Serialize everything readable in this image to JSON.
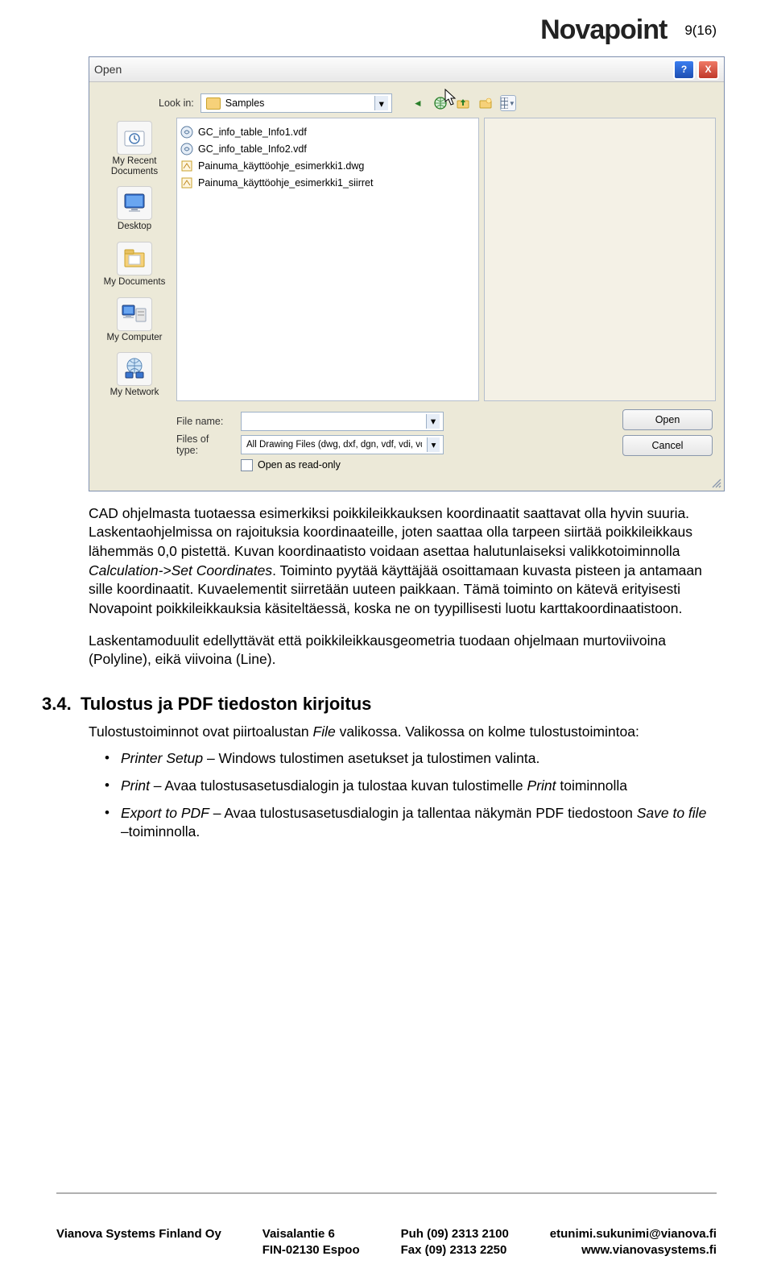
{
  "header": {
    "page_number": "9(16)",
    "logo": "Novapoint"
  },
  "dialog": {
    "title": "Open",
    "help": "?",
    "close": "X",
    "lookin_label": "Look in:",
    "lookin_value": "Samples",
    "nav_icons": {
      "back": "◄",
      "globe": "🌐",
      "up": "folder-up",
      "new": "folder-new",
      "view": "▥"
    },
    "places": [
      {
        "label": "My Recent\nDocuments",
        "icon": "recent"
      },
      {
        "label": "Desktop",
        "icon": "desktop"
      },
      {
        "label": "My Documents",
        "icon": "documents"
      },
      {
        "label": "My Computer",
        "icon": "computer"
      },
      {
        "label": "My Network",
        "icon": "network"
      }
    ],
    "files": [
      {
        "name": "GC_info_table_Info1.vdf",
        "type": "vdf"
      },
      {
        "name": "GC_info_table_Info2.vdf",
        "type": "vdf"
      },
      {
        "name": "Painuma_käyttöohje_esimerkki1.dwg",
        "type": "dwg"
      },
      {
        "name": "Painuma_käyttöohje_esimerkki1_siirret",
        "type": "dwg"
      }
    ],
    "filename_label": "File name:",
    "filetypes_label": "Files of type:",
    "filetypes_value": "All Drawing Files (dwg, dxf, dgn, vdf, vdi, vdp)",
    "readonly_label": "Open as read-only",
    "open_btn": "Open",
    "cancel_btn": "Cancel"
  },
  "body": {
    "p1_a": "CAD ohjelmasta tuotaessa esimerkiksi poikkileikkauksen koordinaatit saattavat olla hyvin suuria. Laskentaohjelmissa on rajoituksia koordinaateille, joten saattaa olla tarpeen siirtää poikkileikkaus lähemmäs 0,0 pistettä. Kuvan koordinaatisto voidaan asettaa halutunlaiseksi valikkotoiminnolla ",
    "p1_i": "Calculation->Set Coordinates",
    "p1_b": ". Toiminto pyytää käyttäjää osoittamaan kuvasta pisteen ja antamaan sille koordinaatit. Kuvaelementit siirretään uuteen paikkaan. Tämä toiminto on kätevä erityisesti Novapoint poikkileikkauksia käsiteltäessä, koska ne on tyypillisesti luotu karttakoordinaatistoon.",
    "p2": "Laskentamoduulit edellyttävät että poikkileikkausgeometria tuodaan ohjelmaan murtoviivoina (Polyline), eikä viivoina (Line)."
  },
  "section": {
    "number": "3.4.",
    "title": "Tulostus ja PDF tiedoston kirjoitus",
    "intro_a": "Tulostustoiminnot ovat piirtoalustan ",
    "intro_i": "File",
    "intro_b": " valikossa. Valikossa on kolme tulostustoimintoa:",
    "bullets": [
      {
        "i": "Printer Setup",
        "t": " – Windows tulostimen asetukset ja tulostimen valinta."
      },
      {
        "i": "Print",
        "t": " – Avaa tulostusasetusdialogin ja tulostaa kuvan tulostimelle ",
        "i2": "Print",
        "t2": " toiminnolla"
      },
      {
        "i": "Export to PDF",
        "t": " – Avaa tulostusasetusdialogin ja tallentaa näkymän PDF tiedostoon ",
        "i2": "Save to file",
        "t2": " –toiminnolla."
      }
    ]
  },
  "footer": {
    "c1a": "Vianova Systems Finland Oy",
    "c2a": "Vaisalantie 6",
    "c2b": "FIN-02130 Espoo",
    "c3a": "Puh  (09) 2313 2100",
    "c3b": "Fax  (09) 2313 2250",
    "c4a": "etunimi.sukunimi@vianova.fi",
    "c4b": "www.vianovasystems.fi"
  }
}
